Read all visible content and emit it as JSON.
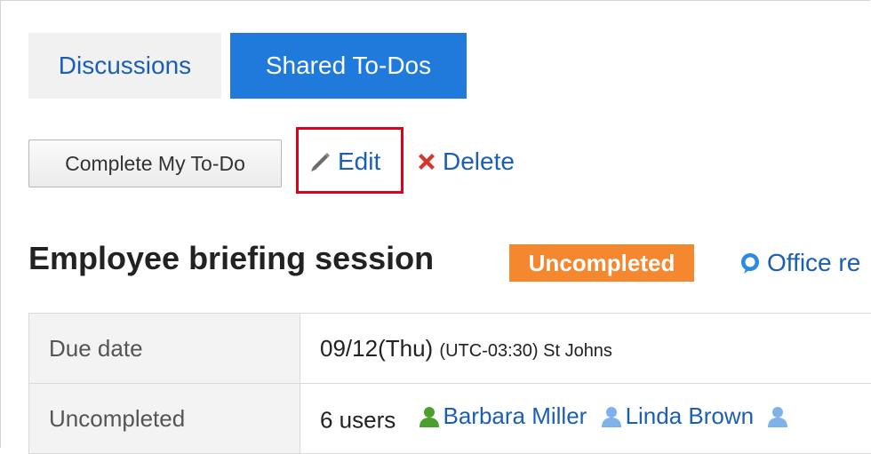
{
  "tabs": {
    "discussions": "Discussions",
    "shared_todos": "Shared To-Dos"
  },
  "toolbar": {
    "complete_label": "Complete My To-Do",
    "edit_label": "Edit",
    "delete_label": "Delete"
  },
  "todo": {
    "title": "Employee briefing session",
    "status": "Uncompleted",
    "category": "Office re"
  },
  "details": {
    "due_label": "Due date",
    "due_date": "09/12(Thu)",
    "due_timezone": "(UTC-03:30) St Johns",
    "uncompleted_label": "Uncompleted",
    "uncompleted_count": "6 users",
    "users": [
      "Barbara Miller",
      "Linda Brown",
      ""
    ]
  },
  "colors": {
    "accent": "#1f7adb",
    "link": "#1b5fb3",
    "status_badge": "#f5872e",
    "highlight": "#e0001c"
  },
  "icons": [
    "pencil-icon",
    "delete-x-icon",
    "category-bubble-icon",
    "user-icon"
  ]
}
